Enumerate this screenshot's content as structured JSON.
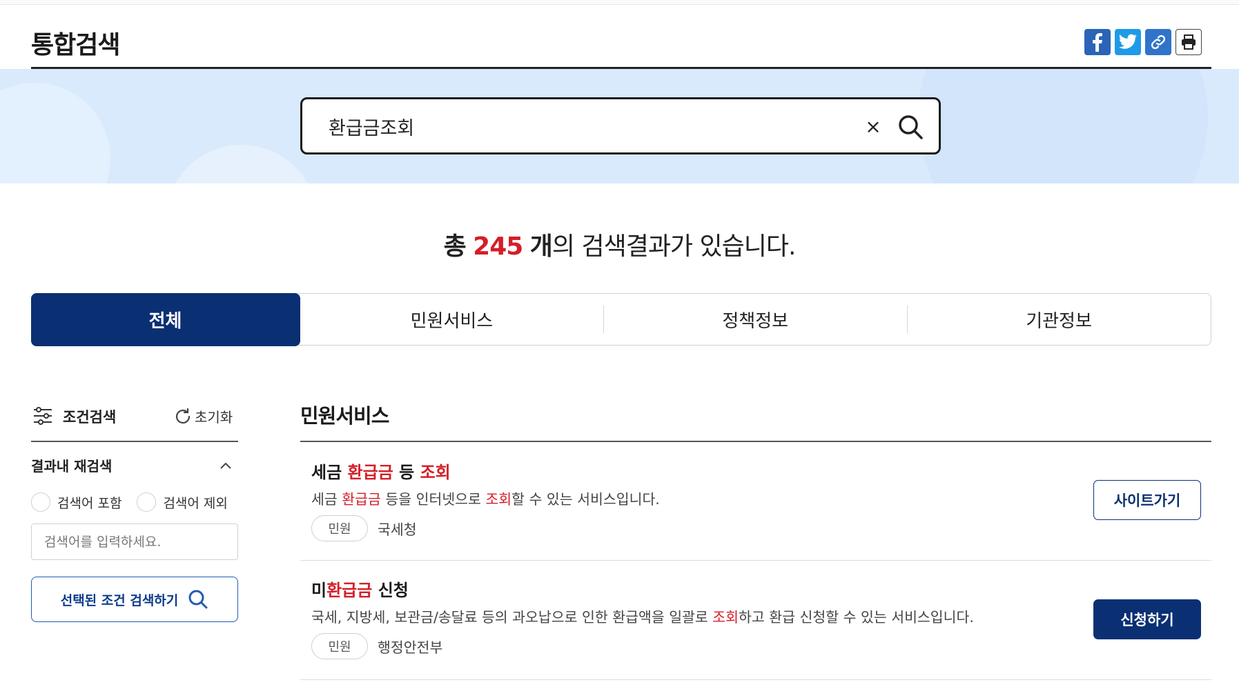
{
  "page": {
    "title": "통합검색"
  },
  "share": {
    "facebook_icon": "facebook-icon",
    "twitter_icon": "twitter-icon",
    "link_icon": "link-icon",
    "print_icon": "print-icon"
  },
  "search": {
    "value": "환급금조회",
    "clear_label": "×"
  },
  "result": {
    "prefix": "총",
    "count": "245",
    "unit": "개",
    "suffix": "의 검색결과가 있습니다."
  },
  "tabs": [
    {
      "label": "전체",
      "active": true
    },
    {
      "label": "민원서비스",
      "active": false
    },
    {
      "label": "정책정보",
      "active": false
    },
    {
      "label": "기관정보",
      "active": false
    }
  ],
  "sidebar": {
    "filter_label": "조건검색",
    "reset_label": "초기화",
    "research_title": "결과내 재검색",
    "include_label": "검색어 포함",
    "exclude_label": "검색어 제외",
    "input_placeholder": "검색어를 입력하세요.",
    "submit_label": "선택된 조건 검색하기"
  },
  "section": {
    "title": "민원서비스",
    "items": [
      {
        "title_parts": [
          "세금 ",
          "환급금",
          " 등 ",
          "조회"
        ],
        "desc_parts": [
          "세금 ",
          "환급금",
          " 등을 인터넷으로 ",
          "조회",
          "할 수 있는 서비스입니다."
        ],
        "tag": "민원",
        "org": "국세청",
        "button": "사이트가기"
      },
      {
        "title_parts": [
          "미",
          "환급금",
          " 신청"
        ],
        "desc_parts": [
          "국세, 지방세, 보관금/송달료 등의 과오납으로 인한 환급액을 일괄로 ",
          "조회",
          "하고 환급 신청할 수 있는 서비스입니다."
        ],
        "tag": "민원",
        "org": "행정안전부",
        "button": "신청하기"
      }
    ]
  },
  "colors": {
    "brand": "#0a3073",
    "highlight": "#d41f28",
    "banner": "#d9eafc"
  }
}
